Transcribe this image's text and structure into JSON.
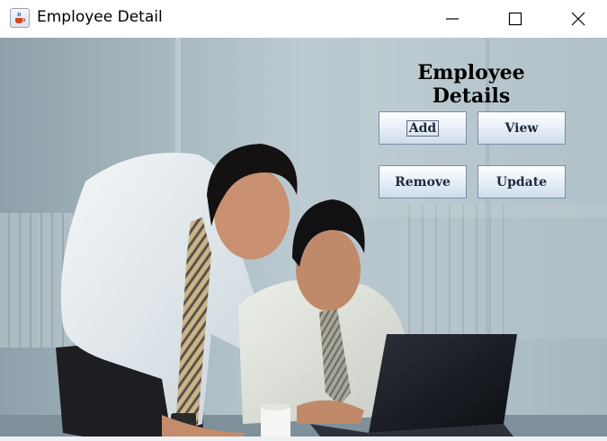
{
  "window": {
    "title": "Employee Detail",
    "icon": "java-cup-icon"
  },
  "main": {
    "heading": "Employee Details",
    "buttons": {
      "add": "Add",
      "view": "View",
      "remove": "Remove",
      "update": "Update"
    }
  },
  "colors": {
    "button_border": "#7a8ea8",
    "background": "#a9bbc3"
  }
}
